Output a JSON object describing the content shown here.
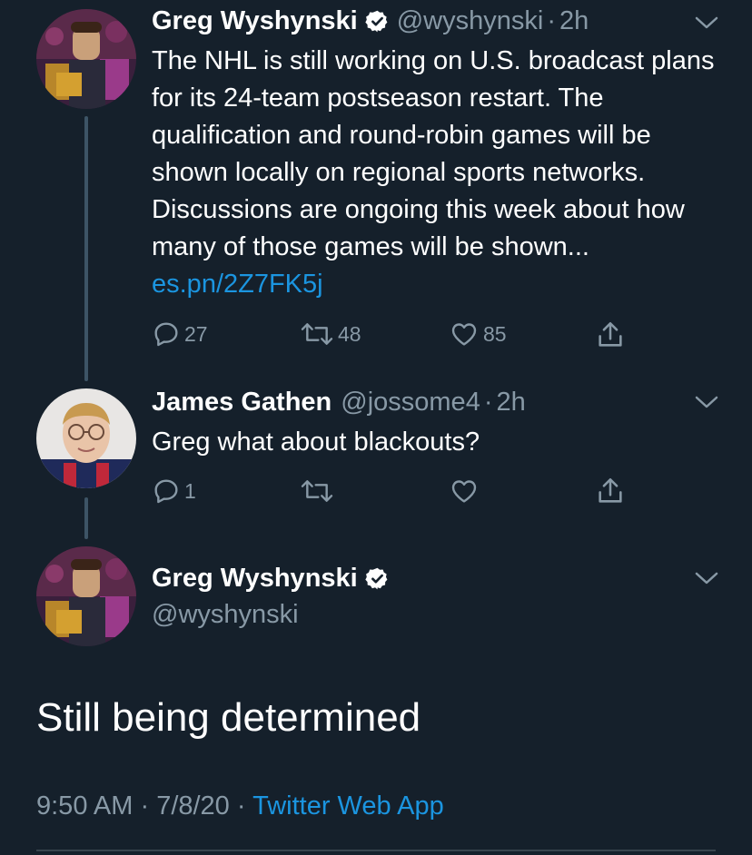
{
  "tweet1": {
    "name": "Greg Wyshynski",
    "handle": "@wyshynski",
    "time": "2h",
    "text": "The NHL is still working on U.S. broadcast plans for its 24-team postseason restart. The qualification and round-robin games will be shown locally on regional sports networks. Discussions are ongoing this week about how many of those games will be shown...",
    "link": "es.pn/2Z7FK5j",
    "replies": "27",
    "retweets": "48",
    "likes": "85"
  },
  "tweet2": {
    "name": "James Gathen",
    "handle": "@jossome4",
    "time": "2h",
    "text": "Greg what about blackouts?",
    "replies": "1"
  },
  "main_tweet": {
    "name": "Greg Wyshynski",
    "handle": "@wyshynski",
    "text": "Still being determined",
    "time": "9:50 AM",
    "date": "7/8/20",
    "source": "Twitter Web App"
  },
  "colors": {
    "background": "#15202b",
    "text_secondary": "#8899a6",
    "link": "#1b95e0",
    "thread_line": "#3d5466"
  },
  "icons": [
    "verified-badge-icon",
    "chevron-down-icon",
    "reply-icon",
    "retweet-icon",
    "like-icon",
    "share-icon"
  ]
}
